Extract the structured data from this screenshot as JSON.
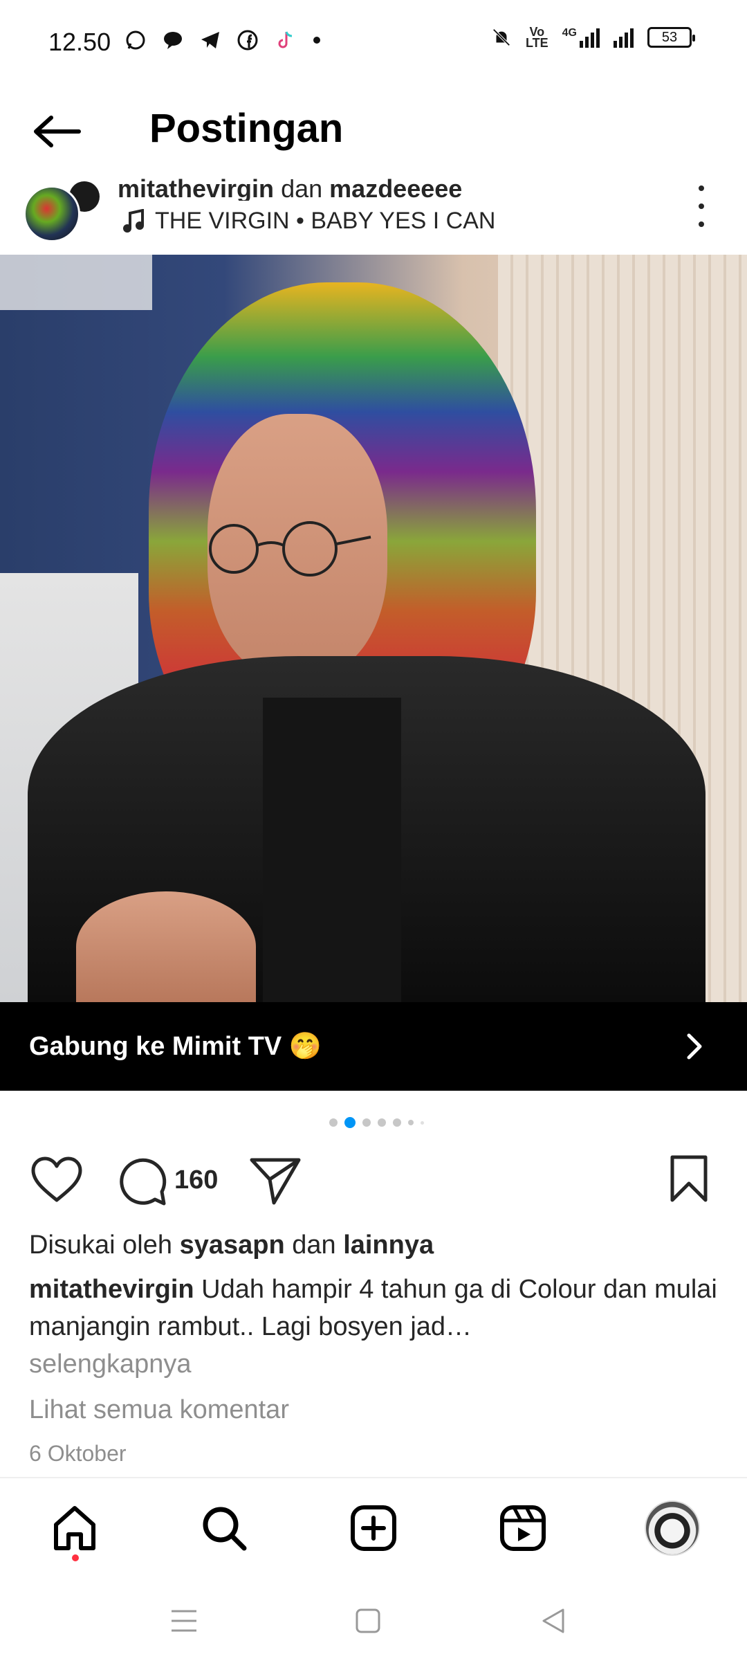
{
  "status_bar": {
    "time": "12.50",
    "volte_line1": "Vo",
    "volte_line2": "LTE",
    "network": "4G",
    "battery": "53",
    "apps": [
      "whatsapp-icon",
      "messages-icon",
      "telegram-icon",
      "facebook-icon",
      "tiktok-icon"
    ]
  },
  "header": {
    "title": "Postingan"
  },
  "post": {
    "user1": "mitathevirgin",
    "connector": "dan",
    "user2": "mazdeeeee",
    "music": "THE VIRGIN • BABY YES I CAN",
    "channel_banner": "Gabung ke Mimit TV 🤭",
    "carousel": {
      "count": 7,
      "active_index": 1
    },
    "comment_count": "160",
    "likes_prefix": "Disukai oleh",
    "likes_user": "syasapn",
    "likes_connector": "dan",
    "likes_others": "lainnya",
    "caption_user": "mitathevirgin",
    "caption_text": "Udah hampir 4 tahun ga di Colour dan mulai manjangin rambut.. Lagi bosyen jad…",
    "more_label": "selengkapnya",
    "view_comments_label": "Lihat semua komentar",
    "date": "6 Oktober"
  },
  "bottom_nav": {
    "items": [
      "home-icon",
      "search-icon",
      "create-icon",
      "reels-icon",
      "profile-avatar"
    ]
  },
  "colors": {
    "accent_blue": "#0095f6",
    "notification_red": "#ff3040",
    "secondary_text": "#8e8e8e"
  }
}
